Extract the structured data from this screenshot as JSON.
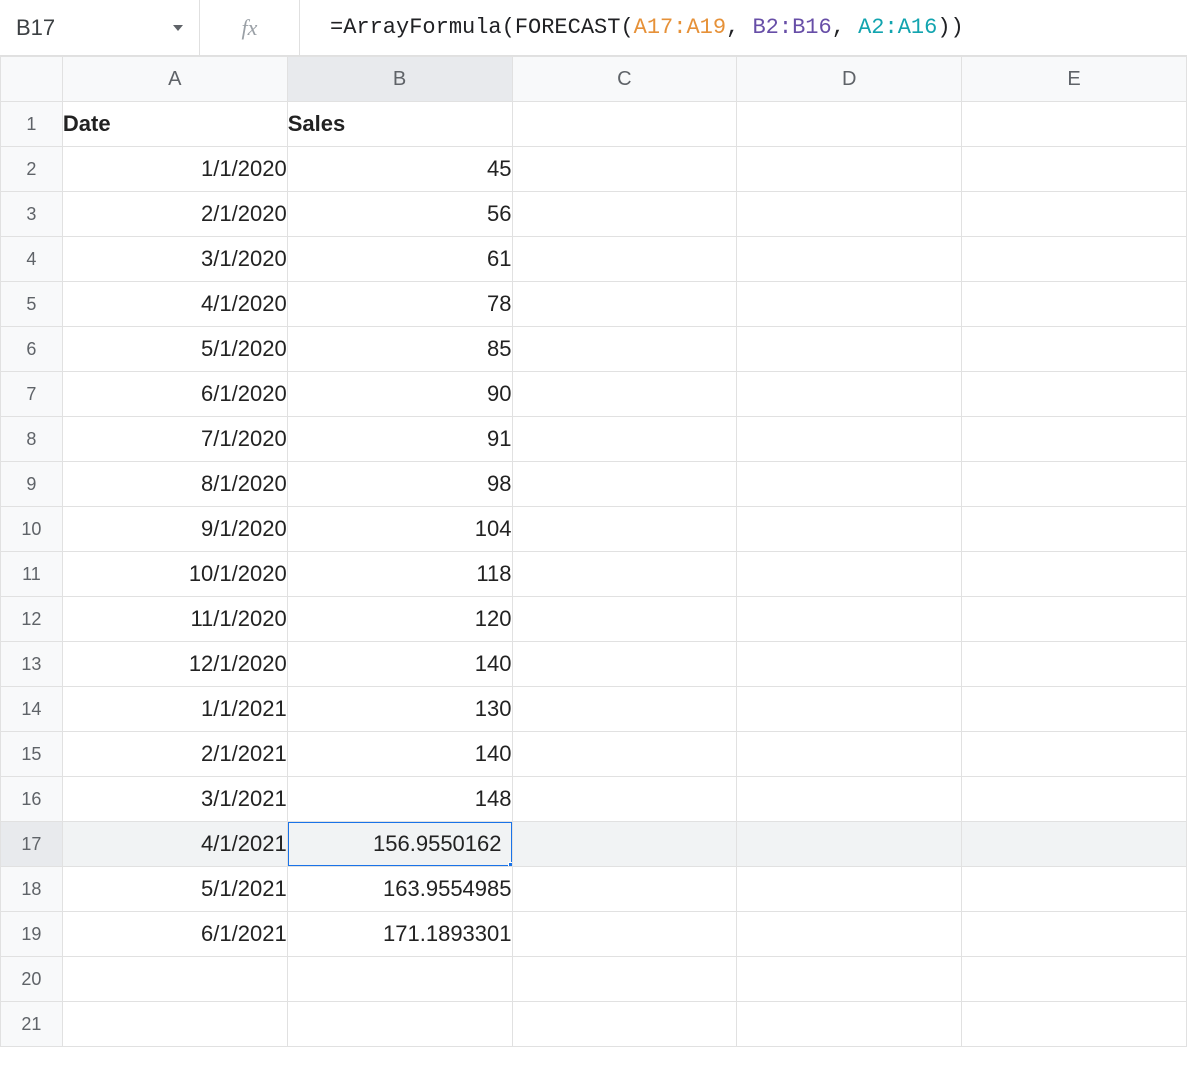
{
  "name_box": "B17",
  "formula": {
    "prefix": "=ArrayFormula(FORECAST(",
    "arg1": "A17:A19",
    "sep1": ", ",
    "arg2": "B2:B16",
    "sep2": ", ",
    "arg3": "A2:A16",
    "suffix": "))"
  },
  "columns": [
    "A",
    "B",
    "C",
    "D",
    "E"
  ],
  "selected_cell": "B17",
  "selected_row": 17,
  "highlight_col_index": 1,
  "headers": {
    "A": "Date",
    "B": "Sales"
  },
  "rows": [
    {
      "n": 1,
      "A": "Date",
      "B": "Sales",
      "bold": true,
      "alignA": "left",
      "alignB": "left"
    },
    {
      "n": 2,
      "A": "1/1/2020",
      "B": "45"
    },
    {
      "n": 3,
      "A": "2/1/2020",
      "B": "56"
    },
    {
      "n": 4,
      "A": "3/1/2020",
      "B": "61"
    },
    {
      "n": 5,
      "A": "4/1/2020",
      "B": "78"
    },
    {
      "n": 6,
      "A": "5/1/2020",
      "B": "85"
    },
    {
      "n": 7,
      "A": "6/1/2020",
      "B": "90"
    },
    {
      "n": 8,
      "A": "7/1/2020",
      "B": "91"
    },
    {
      "n": 9,
      "A": "8/1/2020",
      "B": "98"
    },
    {
      "n": 10,
      "A": "9/1/2020",
      "B": "104"
    },
    {
      "n": 11,
      "A": "10/1/2020",
      "B": "118"
    },
    {
      "n": 12,
      "A": "11/1/2020",
      "B": "120"
    },
    {
      "n": 13,
      "A": "12/1/2020",
      "B": "140"
    },
    {
      "n": 14,
      "A": "1/1/2021",
      "B": "130"
    },
    {
      "n": 15,
      "A": "2/1/2021",
      "B": "140"
    },
    {
      "n": 16,
      "A": "3/1/2021",
      "B": "148"
    },
    {
      "n": 17,
      "A": "4/1/2021",
      "B": "156.9550162",
      "selected": true
    },
    {
      "n": 18,
      "A": "5/1/2021",
      "B": "163.9554985"
    },
    {
      "n": 19,
      "A": "6/1/2021",
      "B": "171.1893301"
    },
    {
      "n": 20,
      "A": "",
      "B": ""
    },
    {
      "n": 21,
      "A": "",
      "B": ""
    }
  ]
}
